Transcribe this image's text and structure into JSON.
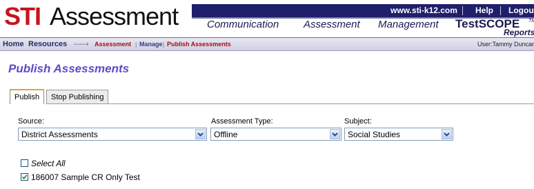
{
  "header": {
    "logo_brand": "STI",
    "logo_product": "Assessment",
    "top_links": {
      "site": "www.sti-k12.com",
      "help": "Help",
      "logout": "Logout"
    },
    "nav": [
      "Communication",
      "Assessment",
      "Management"
    ],
    "testscope": "TestSCOPE",
    "testscope_tm": "TM",
    "testscope_reports": "Reports"
  },
  "breadcrumb": {
    "home": "Home",
    "resources": "Resources",
    "arrow": "——›",
    "assessment": "Assessment",
    "manage": "Manage",
    "publish": "Publish Assessments",
    "divider": "|",
    "user": "User:Tammy Duncan"
  },
  "page": {
    "title": "Publish Assessments"
  },
  "tabs": [
    "Publish",
    "Stop Publishing"
  ],
  "filters": {
    "source": {
      "label": "Source:",
      "value": "District Assessments"
    },
    "type": {
      "label": "Assessment Type:",
      "value": "Offline"
    },
    "subject": {
      "label": "Subject:",
      "value": "Social Studies"
    }
  },
  "assessments": {
    "select_all": {
      "label": "Select All",
      "checked": false
    },
    "items": [
      {
        "label": "186007 Sample CR Only Test",
        "checked": true
      }
    ]
  },
  "colors": {
    "brand_red": "#c8141e",
    "header_navy": "#1f1f6b",
    "title_purple": "#5b4bc8",
    "tab_accent": "#e2a33c"
  }
}
